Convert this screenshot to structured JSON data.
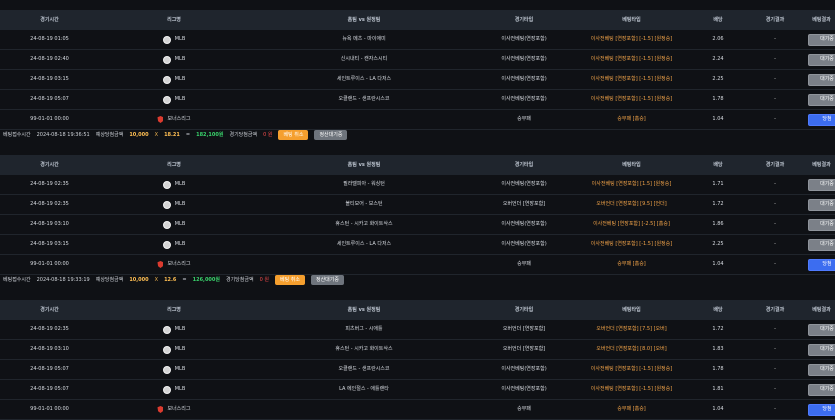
{
  "headers": [
    "경기시간",
    "리그명",
    "홈팀 vs 원정팀",
    "경기타입",
    "베팅타입",
    "배당",
    "경기결과",
    "베팅결과"
  ],
  "sections": [
    {
      "rows": [
        {
          "time": "24-08-19 01:05",
          "league": "MLB",
          "match": "뉴욕 메츠 - 마이애미",
          "match_type": "이사전베팅(연장포함)",
          "bet_type": "이사전베팅 [연장포함] [-1.5] [원정승]",
          "odds": "2.06",
          "result": "-",
          "button": "대기중",
          "icon": "ball"
        },
        {
          "time": "24-08-19 02:40",
          "league": "MLB",
          "match": "신시내티 - 캔자스시티",
          "match_type": "이사전베팅(연장포함)",
          "bet_type": "이사전베팅 [연장포함] [-1.5] [원정승]",
          "odds": "2.24",
          "result": "-",
          "button": "대기중",
          "icon": "ball"
        },
        {
          "time": "24-08-19 03:15",
          "league": "MLB",
          "match": "세인트루이스 - LA 다저스",
          "match_type": "이사전베팅(연장포함)",
          "bet_type": "이사전베팅 [연장포함] [-1.5] [원정승]",
          "odds": "2.25",
          "result": "-",
          "button": "대기중",
          "icon": "ball"
        },
        {
          "time": "24-08-19 05:07",
          "league": "MLB",
          "match": "오클랜드 - 샌프란시스코",
          "match_type": "이사전베팅(연장포함)",
          "bet_type": "이사전베팅 [연장포함] [-1.5] [원정승]",
          "odds": "1.78",
          "result": "-",
          "button": "대기중",
          "icon": "ball"
        },
        {
          "time": "99-01-01 00:00",
          "league": "보너스리그",
          "match": "",
          "match_type": "승무패",
          "bet_type": "승무패 [홈승]",
          "odds": "1.04",
          "result": "-",
          "button": "당첨",
          "icon": "shield",
          "blue": true
        }
      ],
      "summary": {
        "label1": "베팅접수시간",
        "date": "2024-08-18 19:36:51",
        "label2": "예상당첨금액",
        "bet": "10,000",
        "x": "X",
        "odds": "18.21",
        "eq": "=",
        "amount": "182,100원",
        "label3": "경기당첨금액",
        "won": "0 원",
        "btn1": "베팅 취소",
        "btn2": "정산대기중"
      }
    },
    {
      "rows": [
        {
          "time": "24-08-19 02:35",
          "league": "MLB",
          "match": "필라델피아 - 워싱턴",
          "match_type": "이사전베팅(연장포함)",
          "bet_type": "이사전베팅 [연장포함] [1.5] [원정승]",
          "odds": "1.71",
          "result": "-",
          "button": "대기중",
          "icon": "ball"
        },
        {
          "time": "24-08-19 02:35",
          "league": "MLB",
          "match": "볼티모어 - 보스턴",
          "match_type": "오버언더 [연장포함]",
          "bet_type": "오버언더 [연장포함] [9.5] [언더]",
          "odds": "1.72",
          "result": "-",
          "button": "대기중",
          "icon": "ball"
        },
        {
          "time": "24-08-19 03:10",
          "league": "MLB",
          "match": "휴스턴 - 시카고 화이트삭스",
          "match_type": "이사전베팅(연장포함)",
          "bet_type": "이사전베팅 [연장포함] [-2.5] [홈승]",
          "odds": "1.86",
          "result": "-",
          "button": "대기중",
          "icon": "ball"
        },
        {
          "time": "24-08-19 03:15",
          "league": "MLB",
          "match": "세인트루이스 - LA 다저스",
          "match_type": "이사전베팅(연장포함)",
          "bet_type": "이사전베팅 [연장포함] [-1.5] [원정승]",
          "odds": "2.25",
          "result": "-",
          "button": "대기중",
          "icon": "ball"
        },
        {
          "time": "99-01-01 00:00",
          "league": "보너스리그",
          "match": "",
          "match_type": "승무패",
          "bet_type": "승무패 [홈승]",
          "odds": "1.04",
          "result": "-",
          "button": "당첨",
          "icon": "shield",
          "blue": true
        }
      ],
      "summary": {
        "label1": "베팅접수시간",
        "date": "2024-08-18 19:33:19",
        "label2": "예상당첨금액",
        "bet": "10,000",
        "x": "X",
        "odds": "12.6",
        "eq": "=",
        "amount": "126,000원",
        "label3": "경기당첨금액",
        "won": "0 원",
        "btn1": "베팅 취소",
        "btn2": "정산대기중"
      }
    },
    {
      "rows": [
        {
          "time": "24-08-19 02:35",
          "league": "MLB",
          "match": "피츠버그 - 시애틀",
          "match_type": "오버언더 [연장포함]",
          "bet_type": "오버언더 [연장포함] [7.5] [오버]",
          "odds": "1.72",
          "result": "-",
          "button": "대기중",
          "icon": "ball"
        },
        {
          "time": "24-08-19 03:10",
          "league": "MLB",
          "match": "휴스턴 - 시카고 화이트삭스",
          "match_type": "오버언더 [연장포함]",
          "bet_type": "오버언더 [연장포함] [8.0] [오버]",
          "odds": "1.83",
          "result": "-",
          "button": "대기중",
          "icon": "ball"
        },
        {
          "time": "24-08-19 05:07",
          "league": "MLB",
          "match": "오클랜드 - 샌프란시스코",
          "match_type": "이사전베팅(연장포함)",
          "bet_type": "이사전베팅 [연장포함] [-1.5] [원정승]",
          "odds": "1.78",
          "result": "-",
          "button": "대기중",
          "icon": "ball"
        },
        {
          "time": "24-08-19 05:07",
          "league": "MLB",
          "match": "LA 에인절스 - 애틀랜타",
          "match_type": "이사전베팅(연장포함)",
          "bet_type": "이사전베팅 [연장포함] [-1.5] [원정승]",
          "odds": "1.81",
          "result": "-",
          "button": "대기중",
          "icon": "ball"
        },
        {
          "time": "99-01-01 00:00",
          "league": "보너스리그",
          "match": "",
          "match_type": "승무패",
          "bet_type": "승무패 [홈승]",
          "odds": "1.04",
          "result": "-",
          "button": "당첨",
          "icon": "shield",
          "blue": true
        }
      ]
    }
  ]
}
